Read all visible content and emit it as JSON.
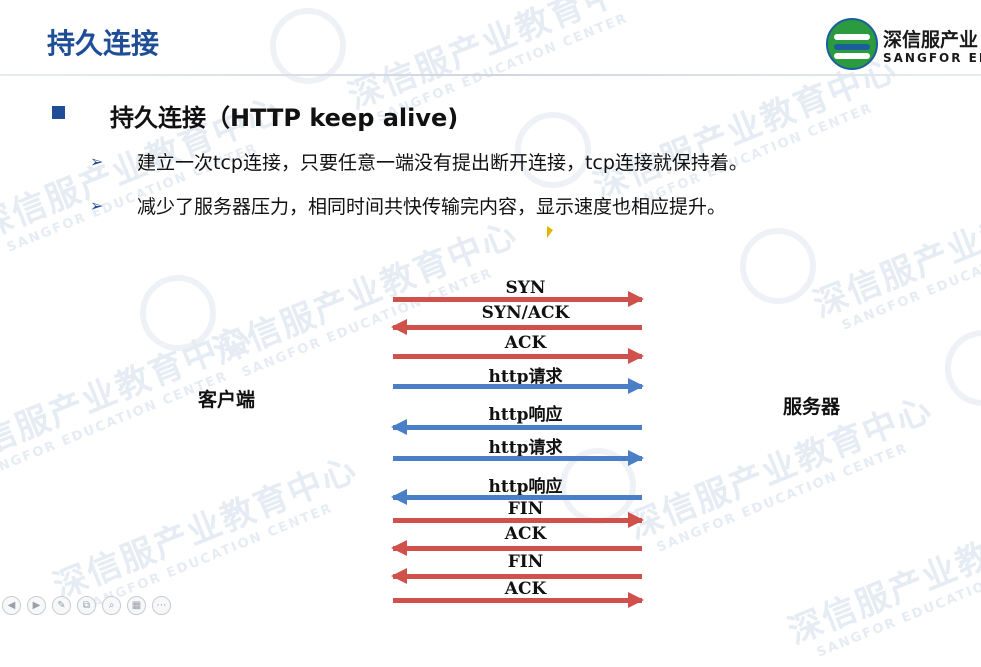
{
  "slide": {
    "title": "持久连接",
    "heading": "持久连接（HTTP keep alive)",
    "points": [
      "建立一次tcp连接，只要任意一端没有提出断开连接，tcp连接就保持着。",
      "减少了服务器压力，相同时间共快传输完内容，显示速度也相应提升。"
    ],
    "bullet_marker": "➢"
  },
  "logo": {
    "name_cn": "深信服产业",
    "name_en": "SANGFOR EDU",
    "colors": {
      "green": "#2c9a3f",
      "blue": "#1b5e9c"
    }
  },
  "diagram": {
    "client_label": "客户端",
    "server_label": "服务器",
    "messages": [
      {
        "label": "SYN",
        "direction": "right",
        "color": "red"
      },
      {
        "label": "SYN/ACK",
        "direction": "left",
        "color": "red"
      },
      {
        "label": "ACK",
        "direction": "right",
        "color": "red"
      },
      {
        "label": "http请求",
        "direction": "right",
        "color": "blue"
      },
      {
        "label": "http响应",
        "direction": "left",
        "color": "blue"
      },
      {
        "label": "http请求",
        "direction": "right",
        "color": "blue"
      },
      {
        "label": "http响应",
        "direction": "left",
        "color": "blue"
      },
      {
        "label": "FIN",
        "direction": "right",
        "color": "red"
      },
      {
        "label": "ACK",
        "direction": "left",
        "color": "red"
      },
      {
        "label": "FIN",
        "direction": "left",
        "color": "red"
      },
      {
        "label": "ACK",
        "direction": "right",
        "color": "red"
      }
    ],
    "colors": {
      "red": "#d0504b",
      "blue": "#4a7fc7"
    }
  },
  "watermark": {
    "cn": "深信服产业教育中心",
    "en": "SANGFOR EDUCATION CENTER"
  },
  "toolbar": {
    "icons": [
      "prev-icon",
      "play-icon",
      "pen-icon",
      "copy-icon",
      "zoom-icon",
      "grid-icon",
      "more-icon"
    ],
    "glyphs": [
      "◀",
      "▶",
      "✎",
      "⧉",
      "⌕",
      "▦",
      "⋯"
    ]
  }
}
